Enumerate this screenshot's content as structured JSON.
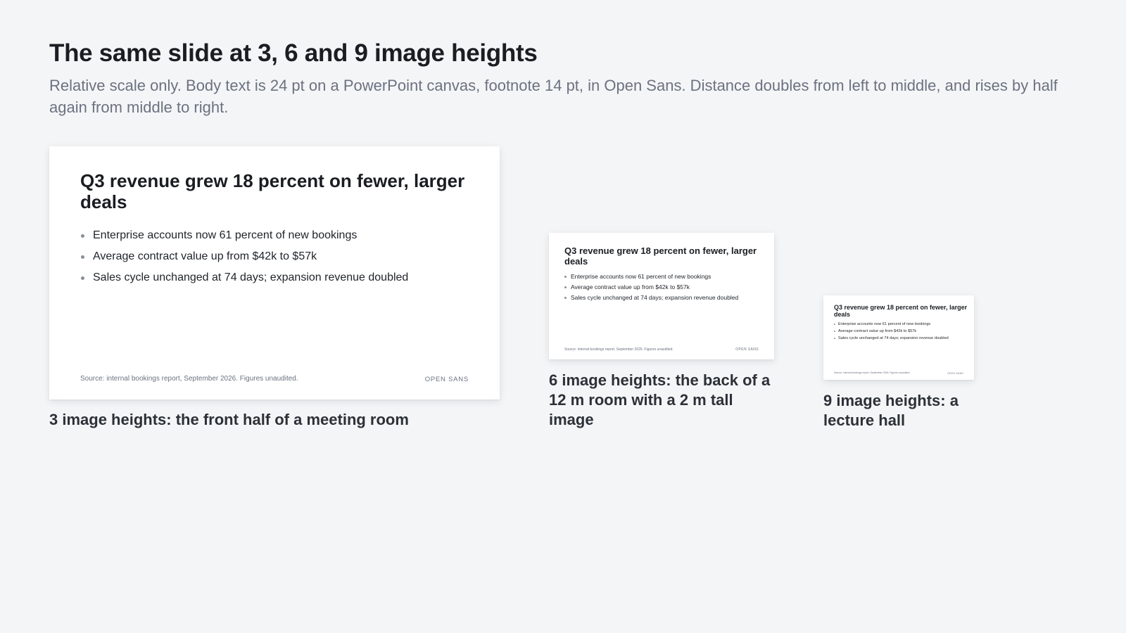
{
  "page": {
    "title": "The same slide at 3, 6 and 9 image heights",
    "subtitle": "Relative scale only. Body text is 24 pt on a PowerPoint canvas, footnote 14 pt, in Open Sans. Distance doubles from left to middle, and rises by half again from middle to right."
  },
  "slide": {
    "title": "Q3 revenue grew 18 percent on fewer, larger deals",
    "bullets": [
      "Enterprise accounts now 61 percent of new bookings",
      "Average contract value up from $42k to $57k",
      "Sales cycle unchanged at 74 days; expansion revenue doubled"
    ],
    "source": "Source: internal bookings report, September 2026. Figures unaudited.",
    "font_tag": "OPEN SANS"
  },
  "captions": {
    "large": "3 image heights: the front half of a meeting room",
    "medium": "6 image heights: the back of a 12 m room with a 2 m tall image",
    "small": "9 image heights: a lecture hall"
  },
  "colors": {
    "background": "#f4f5f7",
    "slide_background": "#ffffff",
    "title_text": "#1a1d21",
    "subtitle_text": "#6b7280",
    "caption_text": "#2c3138"
  }
}
